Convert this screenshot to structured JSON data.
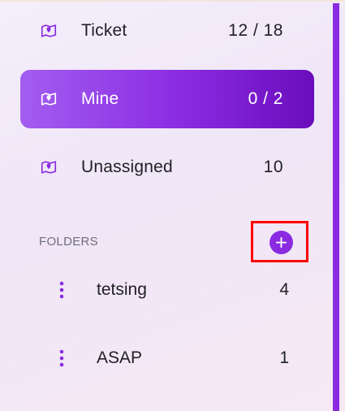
{
  "nav": {
    "items": [
      {
        "label": "Ticket",
        "count": "12 / 18",
        "icon": "map-icon",
        "active": false
      },
      {
        "label": "Mine",
        "count": "0 / 2",
        "icon": "map-icon",
        "active": true
      },
      {
        "label": "Unassigned",
        "count": "10",
        "icon": "map-icon",
        "active": false
      }
    ]
  },
  "folders": {
    "header": "FOLDERS",
    "add_icon": "plus-icon",
    "items": [
      {
        "label": "tetsing",
        "count": "4"
      },
      {
        "label": "ASAP",
        "count": "1"
      }
    ]
  },
  "colors": {
    "accent": "#8a2be2",
    "active_gradient_start": "#a35df0",
    "active_gradient_end": "#6a0dbb",
    "highlight": "#ff0000"
  }
}
